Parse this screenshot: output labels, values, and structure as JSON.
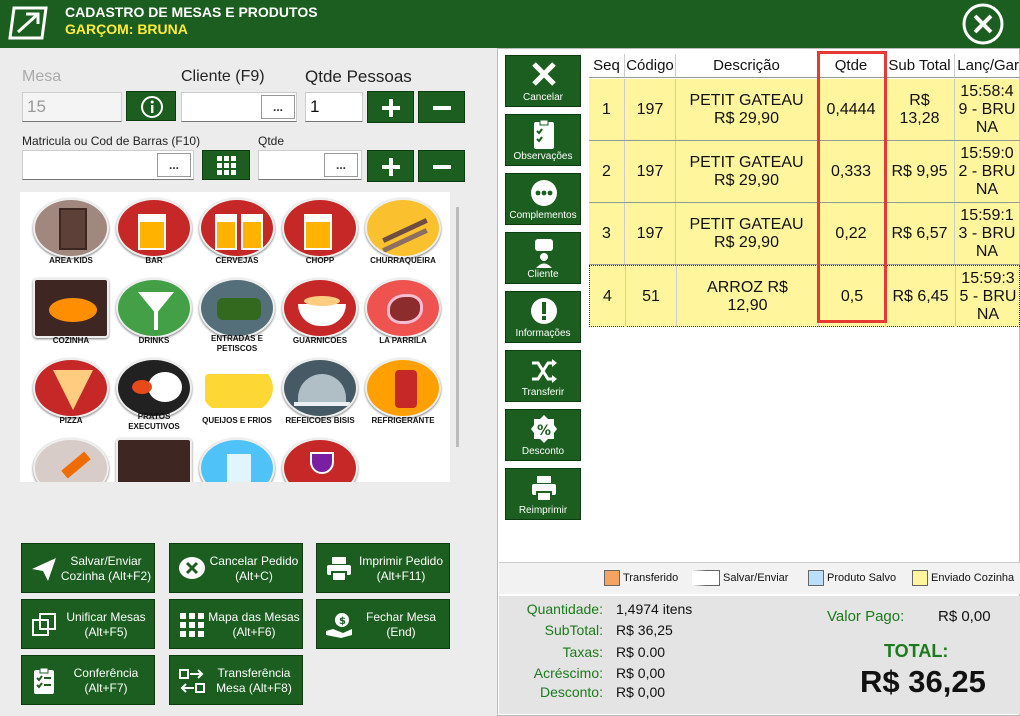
{
  "header": {
    "title": "CADASTRO DE MESAS E PRODUTOS",
    "waiter": "GARÇOM: BRUNA"
  },
  "form": {
    "mesa_label": "Mesa",
    "mesa_value": "15",
    "cliente_label": "Cliente (F9)",
    "cliente_value": "",
    "pessoas_label": "Qtde Pessoas",
    "pessoas_value": "1",
    "matricula_label": "Matricula ou Cod de Barras (F10)",
    "matricula_value": "",
    "qtde_label": "Qtde",
    "qtde_value": "",
    "dots": "..."
  },
  "categories": [
    "AREA KIDS",
    "BAR",
    "CERVEJAS",
    "CHOPP",
    "CHURRAQUEIRA",
    "COZINHA",
    "DRINKS",
    "ENTRADAS E PETISCOS",
    "GUARNICOES",
    "LA PARRILA",
    "PIZZA",
    "PRATOS EXECUTIVOS",
    "QUEIJOS E FRIOS",
    "REFEICOES BISIS",
    "REFRIGERANTE",
    "",
    "",
    "",
    ""
  ],
  "actions": [
    {
      "label": "Salvar/Enviar Cozinha (Alt+F2)",
      "icon": "send-icon"
    },
    {
      "label": "Cancelar Pedido (Alt+C)",
      "icon": "cancel-chat-icon"
    },
    {
      "label": "Imprimir Pedido (Alt+F11)",
      "icon": "printer-icon"
    },
    {
      "label": "Unificar Mesas (Alt+F5)",
      "icon": "merge-icon"
    },
    {
      "label": "Mapa das Mesas (Alt+F6)",
      "icon": "grid-icon"
    },
    {
      "label": "Fechar Mesa (End)",
      "icon": "payment-icon"
    },
    {
      "label": "Conferência (Alt+F7)",
      "icon": "checklist-icon"
    },
    {
      "label": "Transferência Mesa (Alt+F8)",
      "icon": "transfer-icon"
    }
  ],
  "side_buttons": [
    "Cancelar",
    "Observações",
    "Complementos",
    "Cliente",
    "Informações",
    "Transferir",
    "Desconto",
    "Reimprimir"
  ],
  "table": {
    "headers": [
      "Seq",
      "Código",
      "Descrição",
      "Qtde",
      "Sub Total",
      "Lanç/Gar"
    ],
    "rows": [
      {
        "seq": "1",
        "codigo": "197",
        "descricao": "PETIT GATEAU R$ 29,90",
        "qtde": "0,4444",
        "subtotal": "R$ 13,28",
        "lanc": "15:58:49 - BRUNA"
      },
      {
        "seq": "2",
        "codigo": "197",
        "descricao": "PETIT GATEAU R$ 29,90",
        "qtde": "0,333",
        "subtotal": "R$ 9,95",
        "lanc": "15:59:02 - BRUNA"
      },
      {
        "seq": "3",
        "codigo": "197",
        "descricao": "PETIT GATEAU R$ 29,90",
        "qtde": "0,22",
        "subtotal": "R$ 6,57",
        "lanc": "15:59:13 - BRUNA"
      },
      {
        "seq": "4",
        "codigo": "51",
        "descricao": "ARROZ R$ 12,90",
        "qtde": "0,5",
        "subtotal": "R$ 6,45",
        "lanc": "15:59:35 - BRUNA"
      }
    ]
  },
  "legend": [
    {
      "label": "Transferido",
      "color": "#f4a460"
    },
    {
      "label": "Salvar/Enviar",
      "color": "#ffffff"
    },
    {
      "label": "Produto Salvo",
      "color": "#bbdefb"
    },
    {
      "label": "Enviado Cozinha",
      "color": "#fff59d"
    }
  ],
  "totals": {
    "quantidade_label": "Quantidade:",
    "quantidade": "1,4974 itens",
    "subtotal_label": "SubTotal:",
    "subtotal": "R$ 36,25",
    "taxas_label": "Taxas:",
    "taxas": "R$ 0.00",
    "acrescimo_label": "Acréscimo:",
    "acrescimo": "R$ 0,00",
    "desconto_label": "Desconto:",
    "desconto": "R$ 0,00",
    "valor_pago_label": "Valor Pago:",
    "valor_pago": "R$ 0,00",
    "total_label": "TOTAL:",
    "total": "R$ 36,25"
  },
  "colors": {
    "brand": "#1b5e20",
    "accent": "#ffeb3b",
    "row_sent": "#fff59d",
    "highlight": "#e53935"
  }
}
